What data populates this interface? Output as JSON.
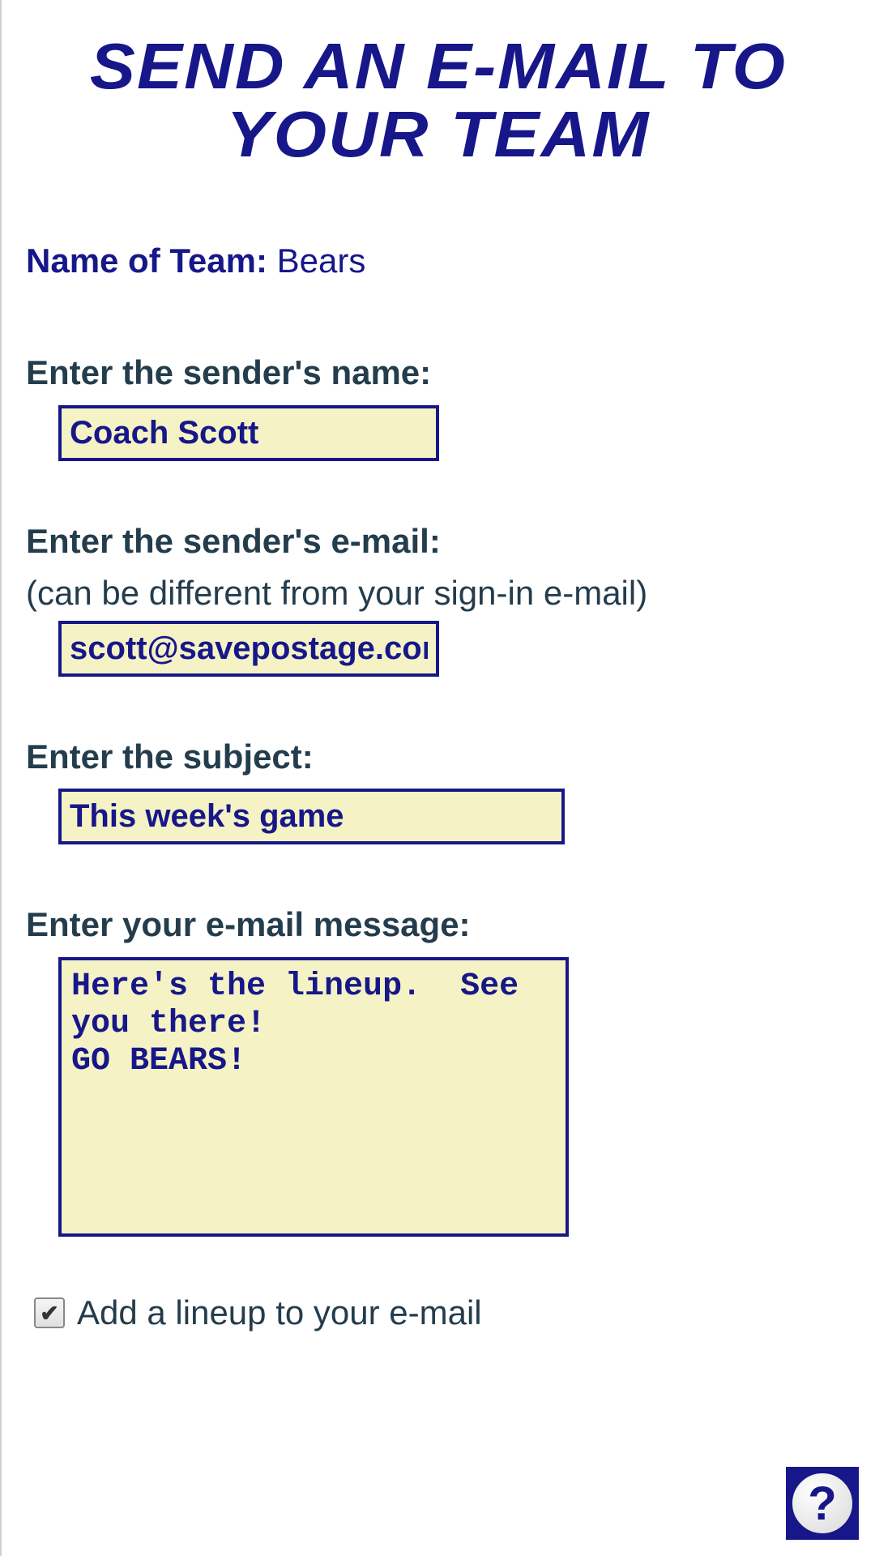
{
  "header": {
    "title": "Send an E-Mail to Your Team"
  },
  "team": {
    "label": "Name of Team: ",
    "value": "Bears"
  },
  "fields": {
    "sender_name": {
      "label": "Enter the sender's name:",
      "value": "Coach Scott"
    },
    "sender_email": {
      "label": "Enter the sender's e-mail:",
      "sublabel": "(can be different from your sign-in e-mail)",
      "value": "scott@savepostage.com"
    },
    "subject": {
      "label": "Enter the subject:",
      "value": "This week's game"
    },
    "message": {
      "label": "Enter your e-mail message:",
      "value": "Here's the lineup.  See you there!\nGO BEARS!"
    }
  },
  "checkbox": {
    "label": "Add a lineup to your e-mail",
    "checked": true,
    "mark": "✔"
  },
  "help": {
    "symbol": "?"
  }
}
